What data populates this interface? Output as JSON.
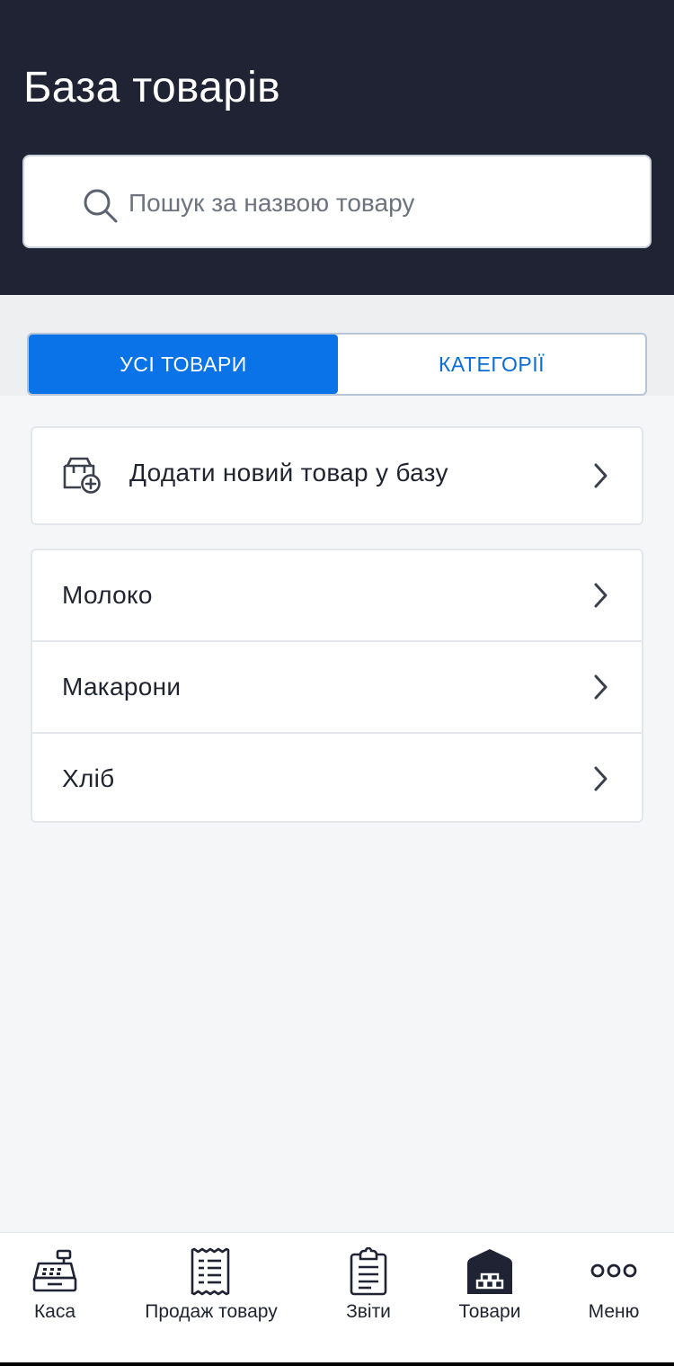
{
  "header": {
    "title": "База товарів",
    "search_placeholder": "Пошук за назвою товару"
  },
  "tabs": [
    {
      "label": "УСІ ТОВАРИ",
      "active": true
    },
    {
      "label": "КАТЕГОРІЇ",
      "active": false
    }
  ],
  "add_product": {
    "label": "Додати новий товар у базу"
  },
  "products": [
    {
      "name": "Молоко"
    },
    {
      "name": "Макарони"
    },
    {
      "name": "Хліб"
    }
  ],
  "bottom_nav": [
    {
      "label": "Каса",
      "icon": "cash-register-icon"
    },
    {
      "label": "Продаж товару",
      "icon": "receipt-icon"
    },
    {
      "label": "Звіти",
      "icon": "clipboard-report-icon"
    },
    {
      "label": "Товари",
      "icon": "warehouse-icon",
      "active": true
    },
    {
      "label": "Меню",
      "icon": "more-dots-icon"
    }
  ],
  "colors": {
    "header_bg": "#1f2333",
    "accent": "#0a73e8",
    "text": "#1f2430"
  }
}
